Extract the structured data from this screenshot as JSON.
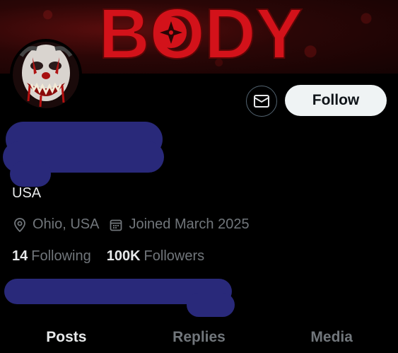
{
  "profile": {
    "banner_text": "BODY",
    "bio": "USA",
    "location": "Ohio, USA",
    "joined": "Joined March 2025",
    "following_count": "14",
    "following_label": "Following",
    "followers_count": "100K",
    "followers_label": "Followers"
  },
  "actions": {
    "follow_label": "Follow",
    "message_icon": "envelope-icon"
  },
  "tabs": [
    {
      "label": "Posts",
      "active": true
    },
    {
      "label": "Replies",
      "active": false
    },
    {
      "label": "Media",
      "active": false
    }
  ],
  "colors": {
    "background": "#000000",
    "banner_text": "#d3121a",
    "follow_button_bg": "#eff3f4",
    "redaction": "#29297a",
    "muted_text": "#71767b"
  }
}
